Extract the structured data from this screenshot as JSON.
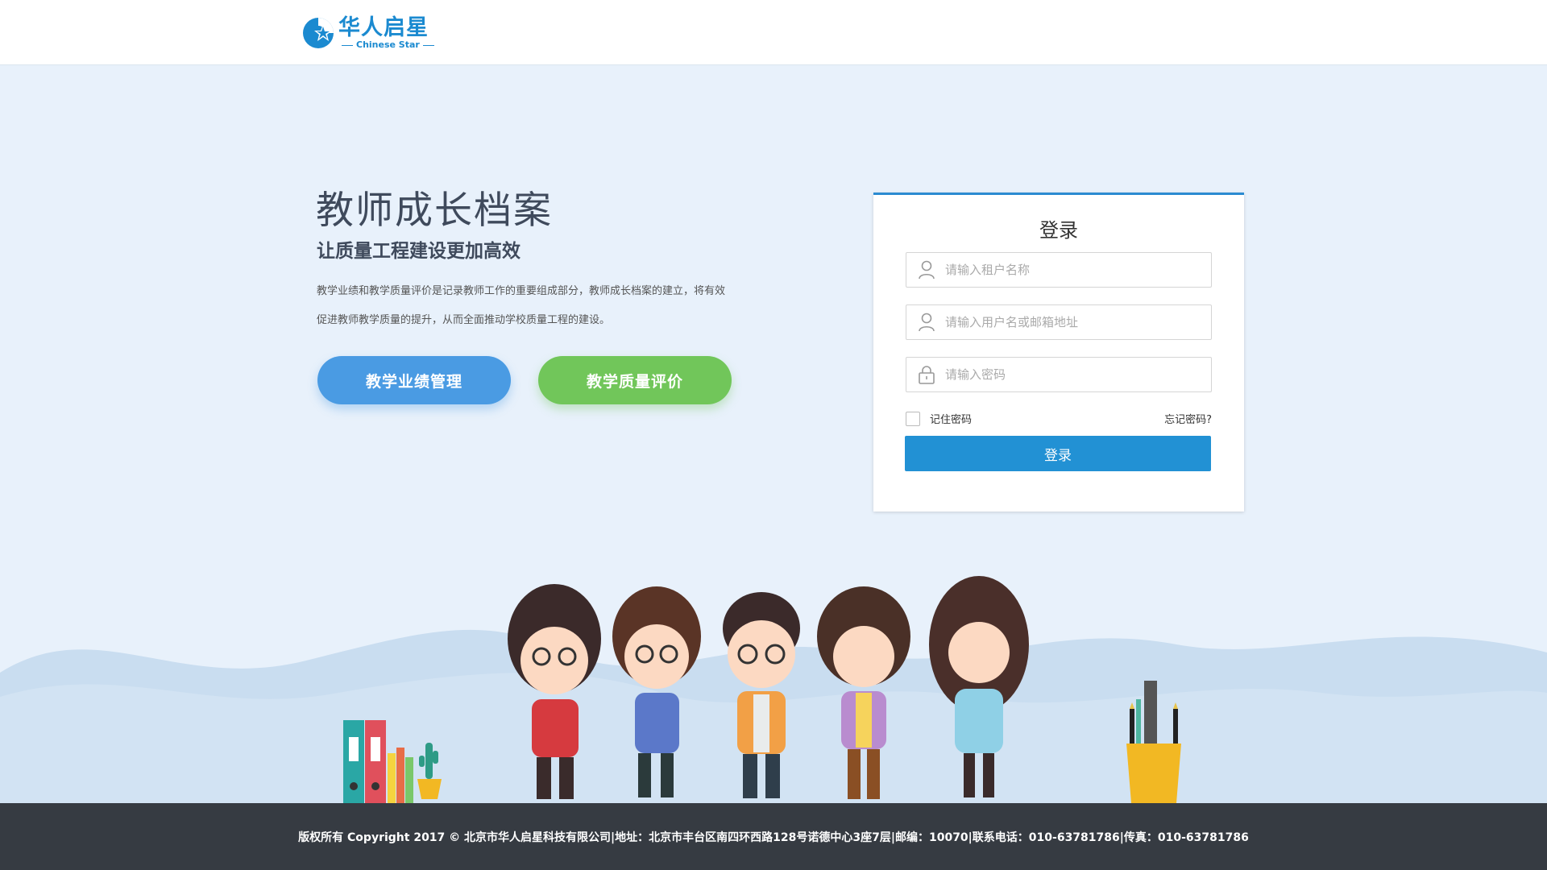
{
  "header": {
    "logo_cn": "华人启星",
    "logo_en": "Chinese Star"
  },
  "hero": {
    "title": "教师成长档案",
    "subtitle": "让质量工程建设更加高效",
    "description_line1": "教学业绩和教学质量评价是记录教师工作的重要组成部分，教师成长档案的建立，将有效",
    "description_line2": "促进教师教学质量的提升，从而全面推动学校质量工程的建设。",
    "btn_performance": "教学业绩管理",
    "btn_quality": "教学质量评价"
  },
  "login": {
    "title": "登录",
    "tenant_placeholder": "请输入租户名称",
    "username_placeholder": "请输入用户名或邮箱地址",
    "password_placeholder": "请输入密码",
    "remember_label": "记住密码",
    "forgot_label": "忘记密码?",
    "submit_label": "登录"
  },
  "footer": {
    "text": "版权所有 Copyright 2017 © 北京市华人启星科技有限公司|地址：北京市丰台区南四环西路128号诺德中心3座7层|邮编：10070|联系电话：010-63781786|传真：010-63781786"
  },
  "icons": {
    "user": "user-icon",
    "lock": "lock-icon"
  },
  "colors": {
    "accent": "#2291d4",
    "blue_button": "#4a9be3",
    "green_button": "#71c65a",
    "footer_bg": "#363b42"
  }
}
